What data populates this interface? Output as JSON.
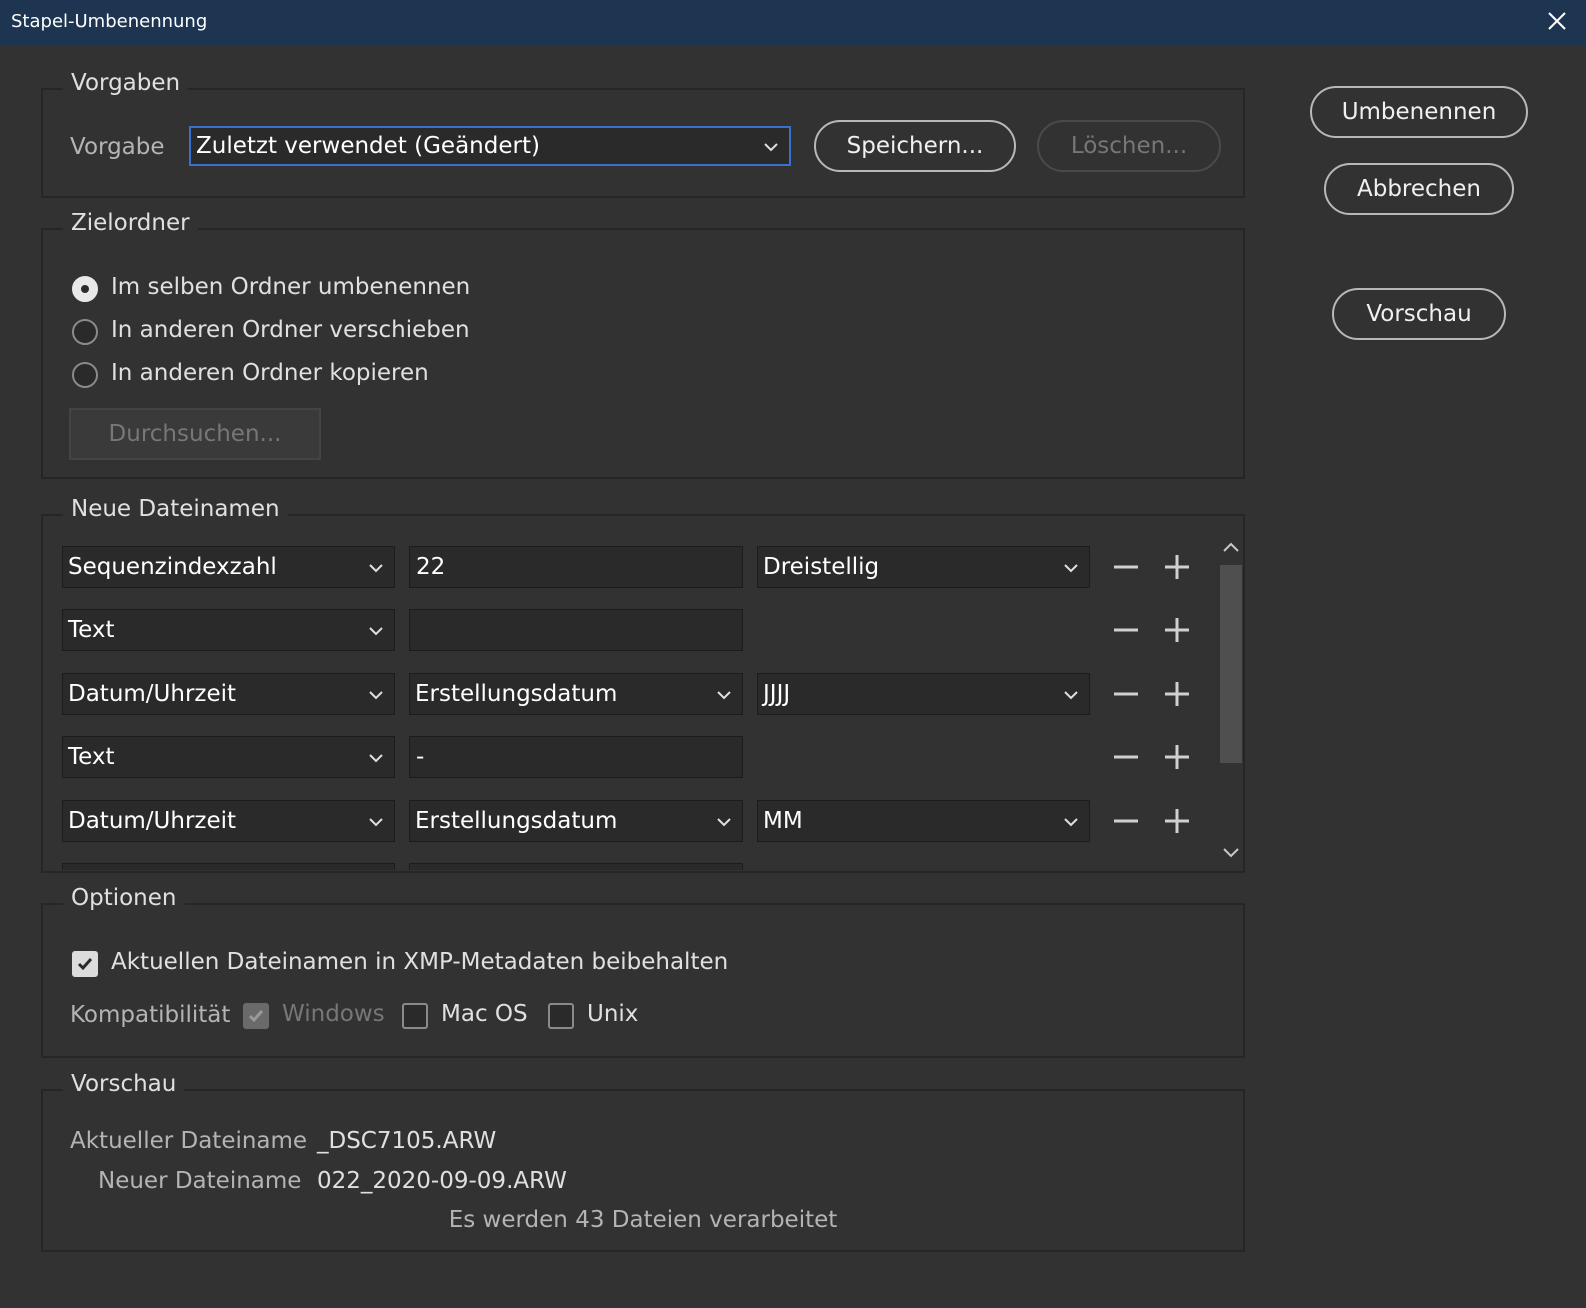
{
  "window": {
    "title": "Stapel-Umbenennung"
  },
  "presets": {
    "legend": "Vorgaben",
    "label": "Vorgabe",
    "selected": "Zuletzt verwendet (Geändert)",
    "save_button": "Speichern...",
    "delete_button": "Löschen..."
  },
  "actions": {
    "rename": "Umbenennen",
    "cancel": "Abbrechen",
    "preview": "Vorschau"
  },
  "target": {
    "legend": "Zielordner",
    "options": [
      {
        "label": "Im selben Ordner umbenennen",
        "selected": true
      },
      {
        "label": "In anderen Ordner verschieben",
        "selected": false
      },
      {
        "label": "In anderen Ordner kopieren",
        "selected": false
      }
    ],
    "browse_button": "Durchsuchen..."
  },
  "filenames": {
    "legend": "Neue Dateinamen",
    "rows": [
      {
        "type": "Sequenzindexzahl",
        "value": "22",
        "format": "Dreistellig"
      },
      {
        "type": "Text",
        "value": ""
      },
      {
        "type": "Datum/Uhrzeit",
        "source": "Erstellungsdatum",
        "format": "JJJJ"
      },
      {
        "type": "Text",
        "value": "-"
      },
      {
        "type": "Datum/Uhrzeit",
        "source": "Erstellungsdatum",
        "format": "MM"
      }
    ]
  },
  "options": {
    "legend": "Optionen",
    "keep_xmp": {
      "label": "Aktuellen Dateinamen in XMP-Metadaten beibehalten",
      "checked": true
    },
    "compat_label": "Kompatibilität",
    "compat": [
      {
        "label": "Windows",
        "checked": true,
        "disabled": true
      },
      {
        "label": "Mac OS",
        "checked": false,
        "disabled": false
      },
      {
        "label": "Unix",
        "checked": false,
        "disabled": false
      }
    ]
  },
  "preview": {
    "legend": "Vorschau",
    "current_label": "Aktueller Dateiname",
    "current_value": "_DSC7105.ARW",
    "new_label": "Neuer Dateiname",
    "new_value": "022_2020-09-09.ARW",
    "summary": "Es werden 43 Dateien verarbeitet"
  },
  "colors": {
    "titlebar": "#1d3551",
    "background": "#323232",
    "focus": "#3d6fd0"
  }
}
